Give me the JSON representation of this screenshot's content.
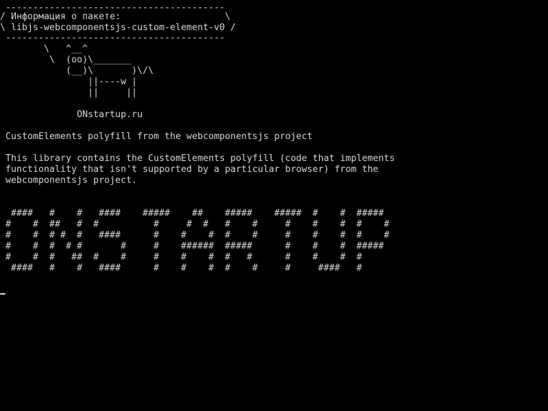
{
  "colors": {
    "background": "#000000",
    "foreground": "#d8d8d8"
  },
  "terminal": {
    "lines": [
      " ----------------------------------------",
      "/ Информация о пакете:                   \\",
      "\\ libjs-webcomponentsjs-custom-element-v0 /",
      " ----------------------------------------",
      "        \\   ^__^",
      "         \\  (oo)\\_______",
      "            (__)\\       )\\/\\",
      "                ||----w |",
      "                ||     ||",
      "",
      "              ONstartup.ru",
      "",
      " CustomElements polyfill from the webcomponentsjs project",
      "",
      " This library contains the CustomElements polyfill (code that implements",
      " functionality that isn't supported by a particular browser) from the",
      " webcomponentsjs project.",
      "",
      "",
      "  ####   #    #   ####    #####    ##    #####    #####  #    #  #####",
      " #    #  ##   #  #          #     #  #   #    #     #    #    #  #    #",
      " #    #  # #  #   ####      #    #    #  #    #     #    #    #  #    #",
      " #    #  #  # #       #     #    ######  #####      #    #    #  #####",
      " #    #  #   ##  #    #     #    #    #  #   #      #    #    #  #",
      "  ####   #    #   ####      #    #    #  #    #     #     ####   #"
    ]
  }
}
